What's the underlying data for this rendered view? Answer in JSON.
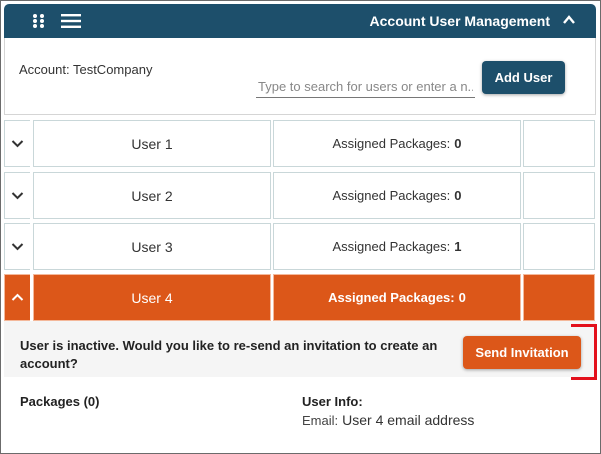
{
  "header": {
    "title": "Account User Management",
    "apps_icon": "apps-grid-icon",
    "menu_icon": "hamburger-menu-icon",
    "collapse_icon": "chevron-up-icon",
    "background_color": "#1d4f6b"
  },
  "account": {
    "label": "Account: TestCompany",
    "search_placeholder": "Type to search for users or enter a n...",
    "add_user_label": "Add User"
  },
  "users": [
    {
      "name": "User 1",
      "packages_label": "Assigned Packages:",
      "packages_count": "0",
      "expanded": false
    },
    {
      "name": "User 2",
      "packages_label": "Assigned Packages:",
      "packages_count": "0",
      "expanded": false
    },
    {
      "name": "User 3",
      "packages_label": "Assigned Packages:",
      "packages_count": "1",
      "expanded": false
    },
    {
      "name": "User 4",
      "packages_label": "Assigned Packages:",
      "packages_count": "0",
      "expanded": true
    }
  ],
  "notice": {
    "text": "User is inactive. Would you like to re-send an invitation to create an account?",
    "send_label": "Send Invitation",
    "accent_color": "#dc5719"
  },
  "details": {
    "packages_label": "Packages (0)",
    "user_info_label": "User Info:",
    "email_label": "Email:",
    "email_value": "User 4 email address"
  }
}
